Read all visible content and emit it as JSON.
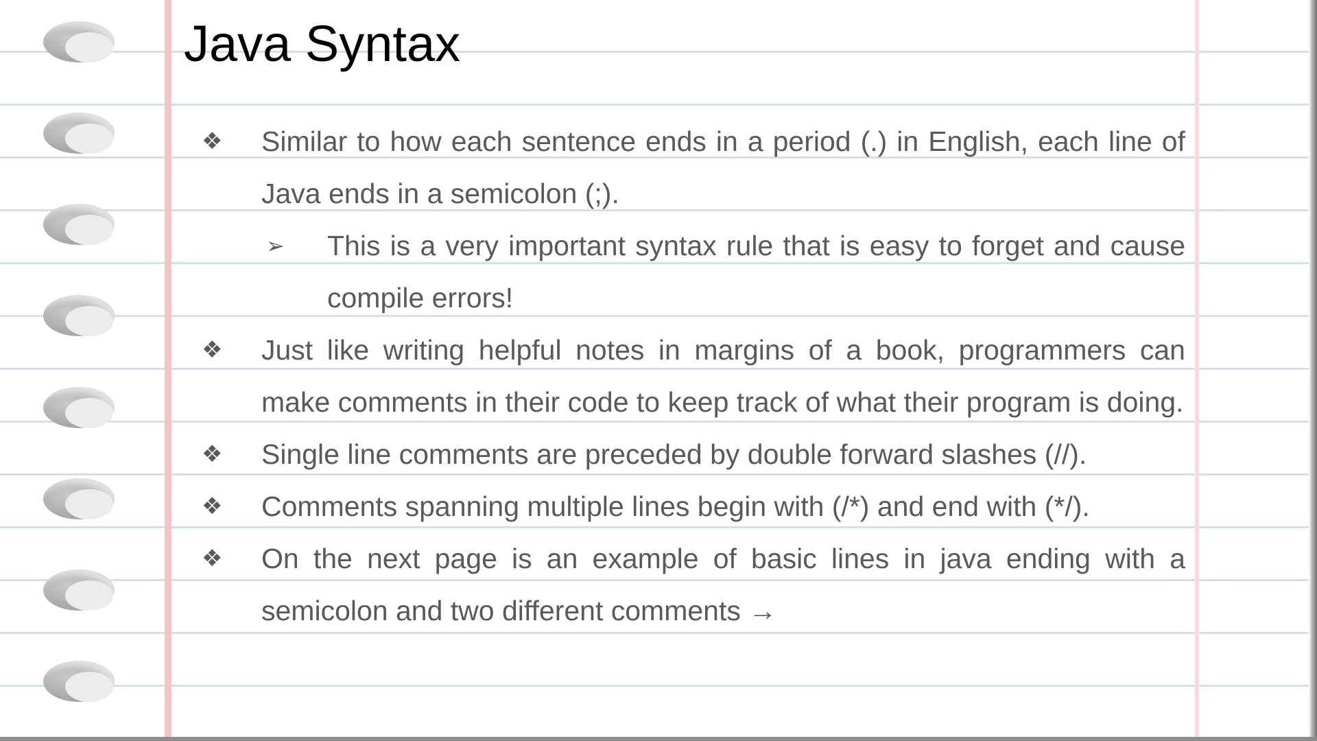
{
  "slide": {
    "title": "Java Syntax",
    "bullets": [
      {
        "marker": "❖",
        "text": "Similar to how each sentence ends in a period (.) in English, each line of Java ends in a semicolon (;)."
      },
      {
        "marker": "➢",
        "text": "This is a very important syntax rule that is easy to forget and cause compile errors!"
      },
      {
        "marker": "❖",
        "text": "Just like writing helpful notes in margins of a book, programmers can make comments in their code to keep track of what their program is doing."
      },
      {
        "marker": "❖",
        "text": "Single line comments are preceded by double forward slashes (//)."
      },
      {
        "marker": "❖",
        "text": "Comments spanning multiple lines begin with (/*) and end with (*/)."
      },
      {
        "marker": "❖",
        "text": "On the next page is an example of basic lines in java ending with a semicolon and two different comments →"
      }
    ]
  },
  "theme": {
    "title_color": "#000000",
    "body_color": "#595959",
    "rule_color": "#d2e1e4",
    "margin_color": "#f3c6c6"
  }
}
